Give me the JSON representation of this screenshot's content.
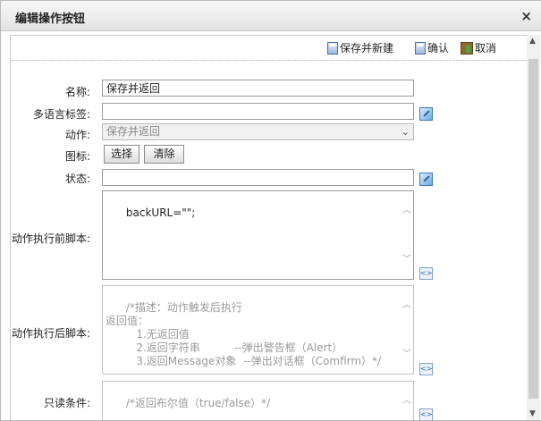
{
  "dialog": {
    "title": "编辑操作按钮",
    "close_label": "×"
  },
  "toolbar": {
    "save_new_label": "保存并新建",
    "confirm_label": "确认",
    "cancel_label": "取消"
  },
  "form": {
    "name_label": "名称:",
    "name_value": "保存并返回",
    "i18n_label": "多语言标签:",
    "i18n_value": "",
    "action_label": "动作:",
    "action_value": "保存并返回",
    "icon_label": "图标:",
    "icon_select_label": "选择",
    "icon_clear_label": "清除",
    "status_label": "状态:",
    "status_value": "",
    "pre_script_label": "动作执行前脚本:",
    "pre_script_value": "backURL=\"\";",
    "post_script_label": "动作执行后脚本:",
    "post_script_placeholder": "/*描述：动作触发后执行\n返回值：\n         1.无返回值\n         2.返回字符串          --弹出警告框（Alert）\n         3.返回Message对象  --弹出对话框（Comfirm）*/",
    "readonly_label": "只读条件:",
    "readonly_placeholder": "/*返回布尔值（true/false）*/"
  },
  "icons": {
    "close": "close-icon",
    "save": "save-icon",
    "cancel": "cancel-icon",
    "edit": "edit-icon",
    "code": "code-icon"
  }
}
